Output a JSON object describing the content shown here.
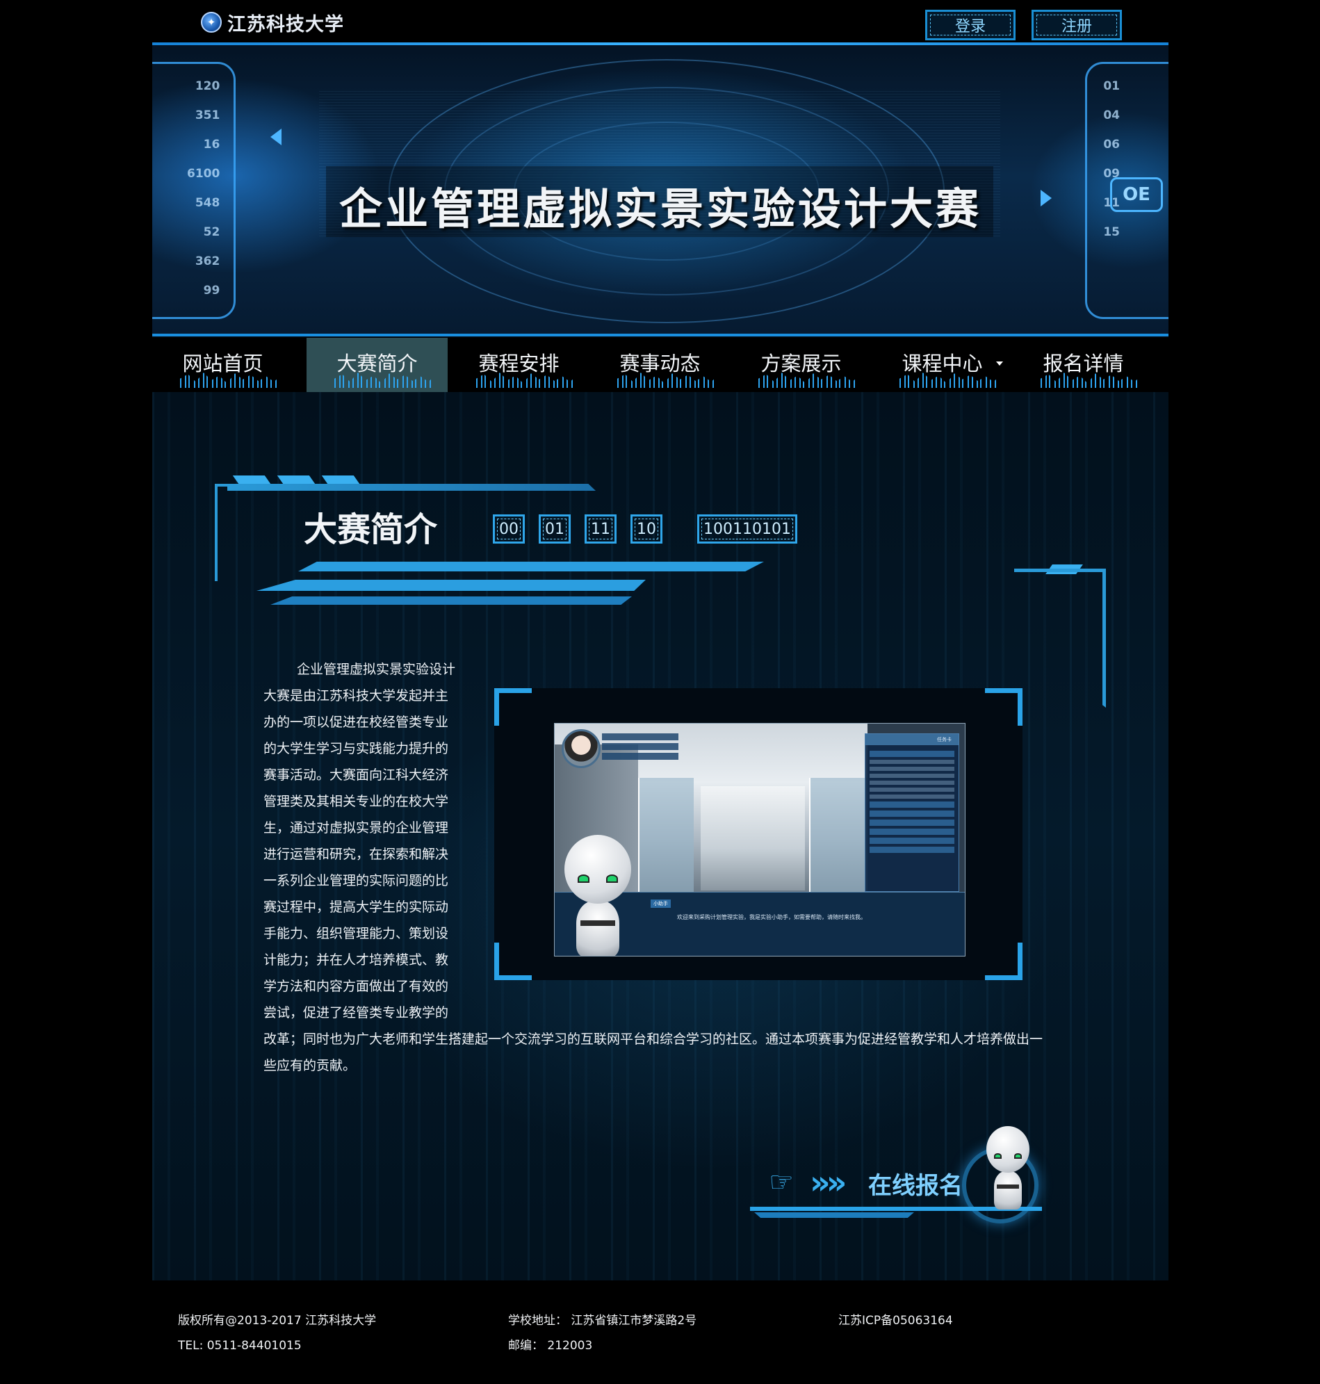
{
  "header": {
    "logo_text": "江苏科技大学",
    "logo_icon": "university-emblem-icon",
    "login_label": "登录",
    "register_label": "注册"
  },
  "banner": {
    "title": "企业管理虚拟实景实验设计大赛",
    "left_numbers": [
      "120",
      "351",
      "16",
      "6100",
      "548",
      "52",
      "362",
      "99"
    ],
    "right_numbers": [
      "01",
      "04",
      "06",
      "09",
      "11",
      "15"
    ],
    "badge": "OE"
  },
  "nav": {
    "items": [
      {
        "label": "网站首页",
        "active": false
      },
      {
        "label": "大赛简介",
        "active": true
      },
      {
        "label": "赛程安排",
        "active": false
      },
      {
        "label": "赛事动态",
        "active": false
      },
      {
        "label": "方案展示",
        "active": false
      },
      {
        "label": "课程中心",
        "active": false,
        "has_dropdown": true
      },
      {
        "label": "报名详情",
        "active": false
      }
    ]
  },
  "section": {
    "title": "大赛简介",
    "codes": [
      "00",
      "01",
      "11",
      "10",
      "100110101"
    ]
  },
  "intro": {
    "lines_narrow": [
      "企业管理虚拟实景实验设计",
      "大赛是由江苏科技大学发起并主",
      "办的一项以促进在校经管类专业",
      "的大学生学习与实践能力提升的",
      "赛事活动。大赛面向江科大经济",
      "管理类及其相关专业的在校大学",
      "生，通过对虚拟实景的企业管理",
      "进行运营和研究，在探索和解决",
      "一系列企业管理的实际问题的比",
      "赛过程中，提高大学生的实际动",
      "手能力、组织管理能力、策划设",
      "计能力；并在人才培养模式、教",
      "学方法和内容方面做出了有效的",
      "尝试，促进了经管类专业教学的"
    ],
    "line_wide_1": "改革；同时也为广大老师和学生搭建起一个交流学习的互联网平台和综合学习的社区。通过本项赛事为促进经管教学和人才培养做出一",
    "line_wide_2": "些应有的贡献。"
  },
  "screenshot": {
    "panel_header": "任务卡",
    "tag": "小助手",
    "message": "欢迎来到采购计划管理实验，我是实验小助手，如需要帮助，请随时来找我。"
  },
  "signup": {
    "label": "在线报名",
    "arrows": "»»"
  },
  "footer": {
    "copyright": "版权所有@2013-2017 江苏科技大学",
    "tel": "TEL: 0511-84401015",
    "address": "学校地址：   江苏省镇江市梦溪路2号",
    "postcode": "邮编：   212003",
    "icp": "江苏ICP备05063164"
  },
  "colors": {
    "accent": "#2aa3e8",
    "nav_active": "#2f4f55",
    "background": "#000000"
  }
}
